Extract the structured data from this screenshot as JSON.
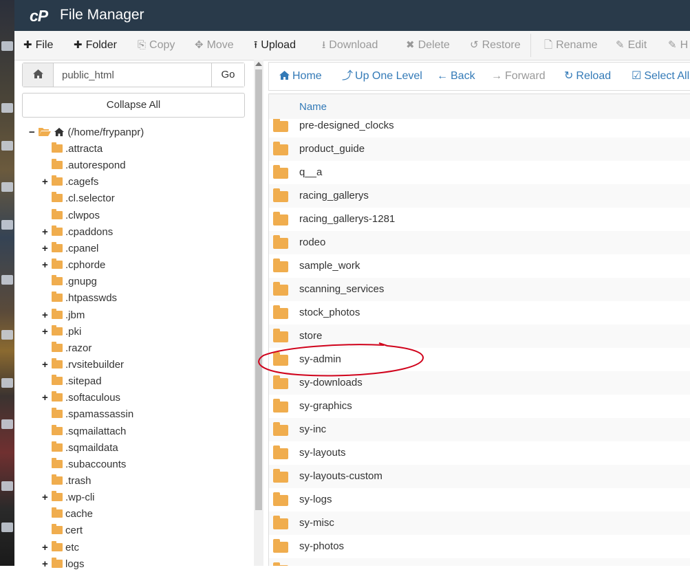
{
  "header": {
    "logo": "cP",
    "title": "File Manager"
  },
  "toolbar": {
    "file": "File",
    "folder": "Folder",
    "copy": "Copy",
    "move": "Move",
    "upload": "Upload",
    "download": "Download",
    "delete": "Delete",
    "restore": "Restore",
    "rename": "Rename",
    "edit": "Edit",
    "html_editor": "H"
  },
  "left": {
    "path_value": "public_html",
    "go": "Go",
    "collapse_all": "Collapse All"
  },
  "tree": {
    "root": "(/home/frypanpr)",
    "items": [
      {
        "label": ".attracta",
        "expandable": false
      },
      {
        "label": ".autorespond",
        "expandable": false
      },
      {
        "label": ".cagefs",
        "expandable": true
      },
      {
        "label": ".cl.selector",
        "expandable": false
      },
      {
        "label": ".clwpos",
        "expandable": false
      },
      {
        "label": ".cpaddons",
        "expandable": true
      },
      {
        "label": ".cpanel",
        "expandable": true
      },
      {
        "label": ".cphorde",
        "expandable": true
      },
      {
        "label": ".gnupg",
        "expandable": false
      },
      {
        "label": ".htpasswds",
        "expandable": false
      },
      {
        "label": ".jbm",
        "expandable": true
      },
      {
        "label": ".pki",
        "expandable": true
      },
      {
        "label": ".razor",
        "expandable": false
      },
      {
        "label": ".rvsitebuilder",
        "expandable": true
      },
      {
        "label": ".sitepad",
        "expandable": false
      },
      {
        "label": ".softaculous",
        "expandable": true
      },
      {
        "label": ".spamassassin",
        "expandable": false
      },
      {
        "label": ".sqmailattach",
        "expandable": false
      },
      {
        "label": ".sqmaildata",
        "expandable": false
      },
      {
        "label": ".subaccounts",
        "expandable": false
      },
      {
        "label": ".trash",
        "expandable": false
      },
      {
        "label": ".wp-cli",
        "expandable": true
      },
      {
        "label": "cache",
        "expandable": false
      },
      {
        "label": "cert",
        "expandable": false
      },
      {
        "label": "etc",
        "expandable": true
      },
      {
        "label": "logs",
        "expandable": true
      }
    ]
  },
  "nav": {
    "home": "Home",
    "up": "Up One Level",
    "back": "Back",
    "forward": "Forward",
    "reload": "Reload",
    "select_all": "Select All"
  },
  "table": {
    "column_name": "Name",
    "rows": [
      "pre-designed_clocks",
      "product_guide",
      "q__a",
      "racing_gallerys",
      "racing_gallerys-1281",
      "rodeo",
      "sample_work",
      "scanning_services",
      "stock_photos",
      "store",
      "sy-admin",
      "sy-downloads",
      "sy-graphics",
      "sy-inc",
      "sy-layouts",
      "sy-layouts-custom",
      "sy-logs",
      "sy-misc",
      "sy-photos",
      ""
    ]
  },
  "colors": {
    "topbar": "#293a4a",
    "folder": "#f0ad4e",
    "link": "#337ab7",
    "annotation": "#d0021b"
  }
}
